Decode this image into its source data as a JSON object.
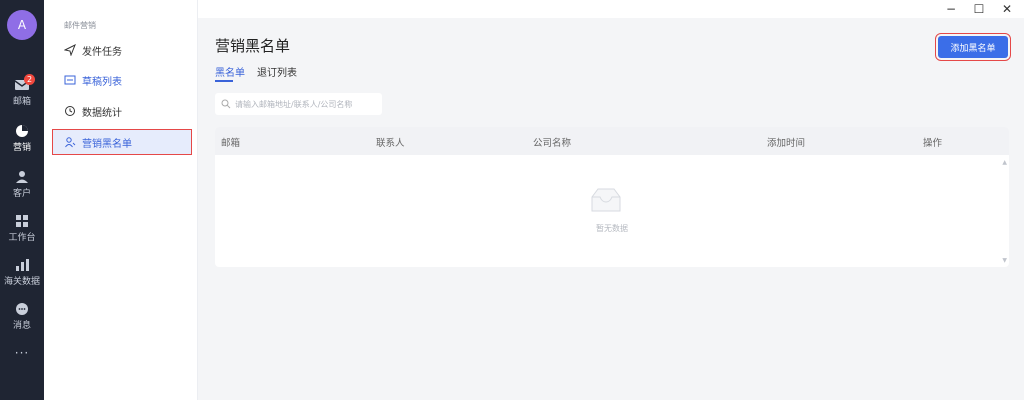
{
  "rail": {
    "avatar_letter": "A",
    "items": [
      {
        "label": "邮箱",
        "badge": "2"
      },
      {
        "label": "营销"
      },
      {
        "label": "客户"
      },
      {
        "label": "工作台"
      },
      {
        "label": "海关数据"
      },
      {
        "label": "消息"
      }
    ],
    "more": "···"
  },
  "submenu": {
    "title": "邮件营销",
    "items": [
      {
        "label": "发件任务"
      },
      {
        "label": "草稿列表"
      },
      {
        "label": "数据统计"
      },
      {
        "label": "营销黑名单"
      }
    ]
  },
  "window": {
    "minimize": "−",
    "maximize": "☐",
    "close": "✕"
  },
  "page": {
    "title": "营销黑名单",
    "add_button": "添加黑名单",
    "tabs": [
      {
        "label": "黑名单"
      },
      {
        "label": "退订列表"
      }
    ],
    "search_placeholder": "请输入邮箱地址/联系人/公司名称",
    "table": {
      "headers": [
        "邮箱",
        "联系人",
        "公司名称",
        "添加时间",
        "操作"
      ],
      "empty_text": "暂无数据"
    }
  },
  "colors": {
    "accent": "#3b6ee8",
    "rail_bg": "#1f2533",
    "highlight_outline": "#e54848"
  }
}
